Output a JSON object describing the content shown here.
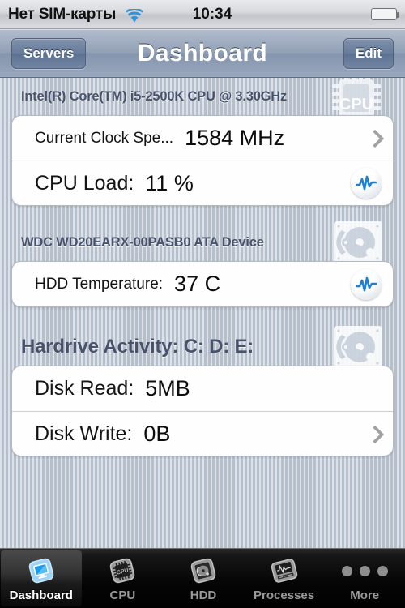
{
  "status_bar": {
    "carrier": "Нет SIM-карты",
    "wifi_icon": "wifi-icon",
    "time": "10:34",
    "battery_icon": "battery-full-icon",
    "battery_color": "#5ec813"
  },
  "nav_bar": {
    "back_label": "Servers",
    "title": "Dashboard",
    "edit_label": "Edit"
  },
  "sections": [
    {
      "id": "cpu",
      "title": "Intel(R) Core(TM) i5-2500K CPU @ 3.30GHz",
      "title_size": "small",
      "badge_icon": "cpu-chip-icon",
      "badge_text": "CPU",
      "rows": [
        {
          "label": "Current Clock Spe...",
          "label_size": "sm",
          "value": "1584 MHz",
          "accessory": "chevron-icon"
        },
        {
          "label": "CPU Load:",
          "label_size": "lg",
          "value": "11 %",
          "accessory": "activity-pulse-icon"
        }
      ]
    },
    {
      "id": "hdd-temp",
      "title": "WDC WD20EARX-00PASB0 ATA Device",
      "title_size": "small",
      "badge_icon": "hard-drive-icon",
      "badge_text": "",
      "rows": [
        {
          "label": "HDD Temperature:",
          "label_size": "sm",
          "value": "37 C",
          "accessory": "activity-pulse-icon"
        }
      ]
    },
    {
      "id": "hardrive-activity",
      "title": "Hardrive Activity:  C: D: E:",
      "title_size": "big",
      "badge_icon": "hard-drive-icon",
      "badge_text": "",
      "rows": [
        {
          "label": "Disk Read:",
          "label_size": "lg",
          "value": "5MB",
          "accessory": "none"
        },
        {
          "label": "Disk Write:",
          "label_size": "lg",
          "value": "0B",
          "accessory": "chevron-icon"
        }
      ]
    }
  ],
  "tab_bar": {
    "items": [
      {
        "label": "Dashboard",
        "icon": "dashboard-monitor-icon",
        "active": true
      },
      {
        "label": "CPU",
        "icon": "cpu-chip-icon",
        "active": false
      },
      {
        "label": "HDD",
        "icon": "hard-drive-icon",
        "active": false
      },
      {
        "label": "Processes",
        "icon": "processes-monitor-icon",
        "active": false
      },
      {
        "label": "More",
        "icon": "more-dots-icon",
        "active": false
      }
    ]
  }
}
